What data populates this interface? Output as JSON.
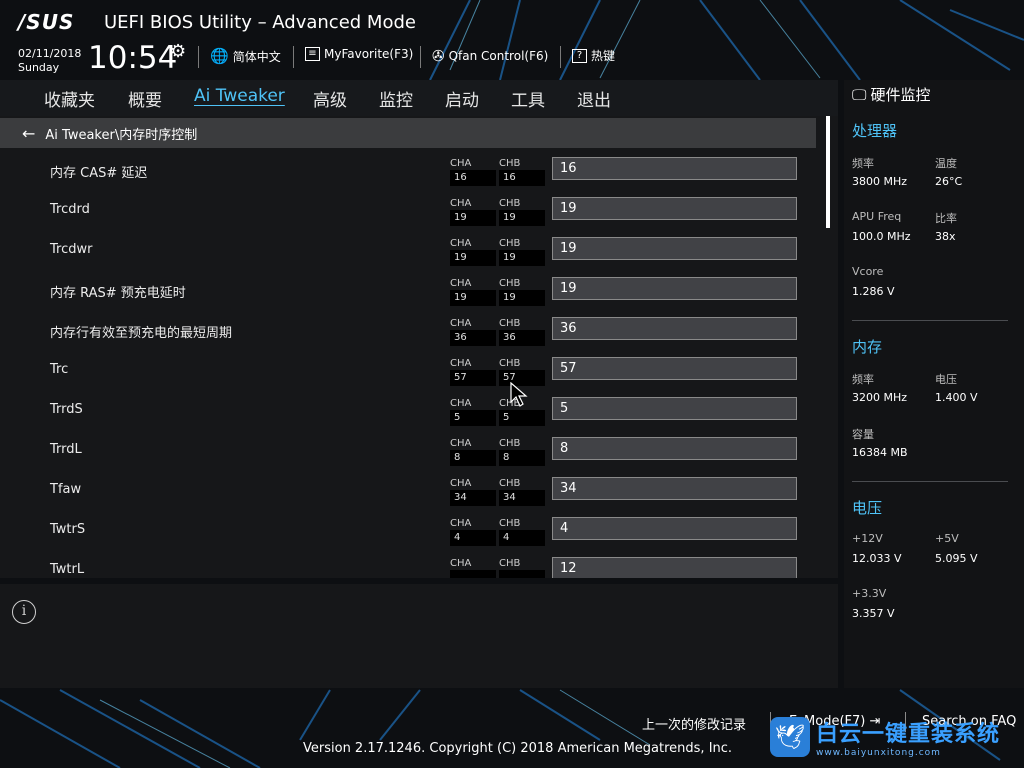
{
  "header": {
    "logo": "/SUS",
    "title": "UEFI BIOS Utility – Advanced Mode",
    "date": "02/11/2018",
    "day": "Sunday",
    "time": "10:54",
    "language_label": "简体中文",
    "myfavorite_label": "MyFavorite(F3)",
    "qfan_label": "Qfan Control(F6)",
    "hotkeys_label": "热键"
  },
  "nav": {
    "tabs": [
      {
        "label": "收藏夹"
      },
      {
        "label": "概要"
      },
      {
        "label": "Ai Tweaker"
      },
      {
        "label": "高级"
      },
      {
        "label": "监控"
      },
      {
        "label": "启动"
      },
      {
        "label": "工具"
      },
      {
        "label": "退出"
      }
    ],
    "active": "Ai Tweaker"
  },
  "breadcrumb": "Ai Tweaker\\内存时序控制",
  "channel_labels": {
    "a": "CHA",
    "b": "CHB"
  },
  "rows": [
    {
      "label": "内存 CAS# 延迟",
      "cha": "16",
      "chb": "16",
      "value": "16"
    },
    {
      "label": "Trcdrd",
      "cha": "19",
      "chb": "19",
      "value": "19"
    },
    {
      "label": "Trcdwr",
      "cha": "19",
      "chb": "19",
      "value": "19"
    },
    {
      "label": "内存 RAS# 预充电延时",
      "cha": "19",
      "chb": "19",
      "value": "19"
    },
    {
      "label": "内存行有效至预充电的最短周期",
      "cha": "36",
      "chb": "36",
      "value": "36"
    },
    {
      "label": "Trc",
      "cha": "57",
      "chb": "57",
      "value": "57"
    },
    {
      "label": "TrrdS",
      "cha": "5",
      "chb": "5",
      "value": "5"
    },
    {
      "label": "TrrdL",
      "cha": "8",
      "chb": "8",
      "value": "8"
    },
    {
      "label": "Tfaw",
      "cha": "34",
      "chb": "34",
      "value": "34"
    },
    {
      "label": "TwtrS",
      "cha": "4",
      "chb": "4",
      "value": "4"
    },
    {
      "label": "TwtrL",
      "cha": "",
      "chb": "",
      "value": "12"
    }
  ],
  "hw_monitor": {
    "title": "硬件监控",
    "cpu": {
      "section": "处理器",
      "freq_label": "频率",
      "freq": "3800 MHz",
      "temp_label": "温度",
      "temp": "26°C",
      "apu_label": "APU Freq",
      "apu": "100.0 MHz",
      "ratio_label": "比率",
      "ratio": "38x",
      "vcore_label": "Vcore",
      "vcore": "1.286 V"
    },
    "memory": {
      "section": "内存",
      "freq_label": "频率",
      "freq": "3200 MHz",
      "volt_label": "电压",
      "volt": "1.400 V",
      "cap_label": "容量",
      "cap": "16384 MB"
    },
    "voltage": {
      "section": "电压",
      "v12_label": "+12V",
      "v12": "12.033 V",
      "v5_label": "+5V",
      "v5": "5.095 V",
      "v33_label": "+3.3V",
      "v33": "3.357 V"
    }
  },
  "footer": {
    "last_modified": "上一次的修改记录",
    "ezmode": "EzMode(F7)",
    "search_faq": "Search on FAQ",
    "version": "Version 2.17.1246. Copyright (C) 2018 American Megatrends, Inc."
  },
  "watermark": {
    "main": "白云一键重装系统",
    "url": "www.baiyunxitong.com"
  },
  "colors": {
    "accent": "#4fc3f7",
    "panel": "#161719",
    "field": "#414246"
  }
}
